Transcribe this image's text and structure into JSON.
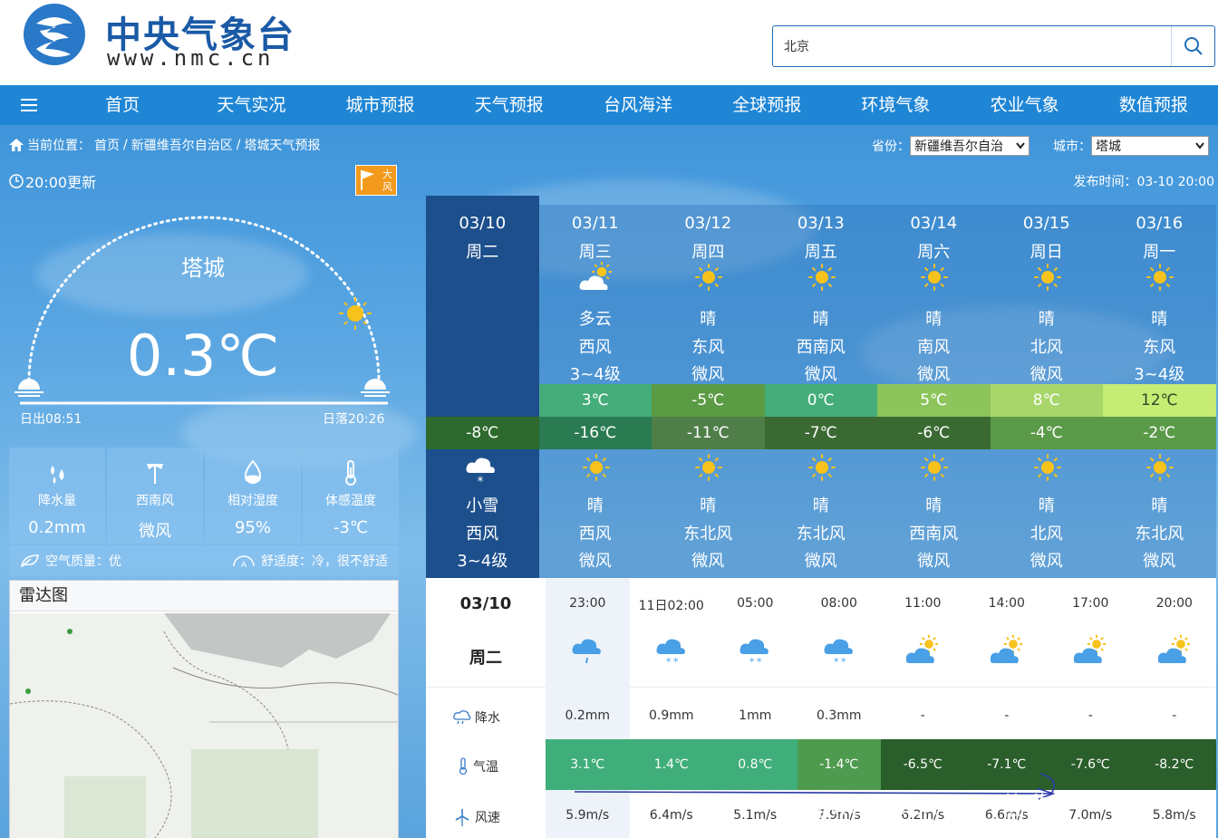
{
  "header": {
    "logo_cn": "中央气象台",
    "logo_en": "www.nmc.cn",
    "search_value": "北京"
  },
  "nav": {
    "items": [
      "首页",
      "天气实况",
      "城市预报",
      "天气预报",
      "台风海洋",
      "全球预报",
      "环境气象",
      "农业气象",
      "数值预报"
    ]
  },
  "breadcrumb": {
    "prefix": "当前位置：",
    "items": [
      "首页",
      "新疆维吾尔自治区",
      "塔城天气预报"
    ]
  },
  "selectors": {
    "province_label": "省份：",
    "province_value": "新疆维吾尔自治",
    "city_label": "城市：",
    "city_value": "塔城"
  },
  "update_time": "20:00更新",
  "warning_badge": {
    "line1": "大",
    "line2": "风",
    "color": "#f39a1c"
  },
  "publish_time": "发布时间：03-10 20:00",
  "current": {
    "city": "塔城",
    "temperature": "0.3℃",
    "sunrise": "日出08:51",
    "sunset": "日落20:26",
    "stats": [
      {
        "icon": "raindrops-icon",
        "label": "降水量",
        "value": "0.2mm"
      },
      {
        "icon": "wind-vane-icon",
        "label": "西南风",
        "value": "微风"
      },
      {
        "icon": "humidity-icon",
        "label": "相对湿度",
        "value": "95%"
      },
      {
        "icon": "thermometer-icon",
        "label": "体感温度",
        "value": "-3℃"
      }
    ],
    "air_quality": "空气质量：优",
    "comfort": "舒适度：冷，很不舒适"
  },
  "radar": {
    "title": "雷达图"
  },
  "forecast": [
    {
      "date": "03/10",
      "weekday": "周二",
      "day_weather": "",
      "day_wind_dir": "",
      "day_wind_level": "",
      "high": "",
      "low": "-8℃",
      "night_weather": "小雪",
      "night_wind_dir": "西风",
      "night_wind_level": "3~4级"
    },
    {
      "date": "03/11",
      "weekday": "周三",
      "day_weather": "多云",
      "day_wind_dir": "西风",
      "day_wind_level": "3~4级",
      "high": "3℃",
      "low": "-16℃",
      "night_weather": "晴",
      "night_wind_dir": "西风",
      "night_wind_level": "微风"
    },
    {
      "date": "03/12",
      "weekday": "周四",
      "day_weather": "晴",
      "day_wind_dir": "东风",
      "day_wind_level": "微风",
      "high": "-5℃",
      "low": "-11℃",
      "night_weather": "晴",
      "night_wind_dir": "东北风",
      "night_wind_level": "微风"
    },
    {
      "date": "03/13",
      "weekday": "周五",
      "day_weather": "晴",
      "day_wind_dir": "西南风",
      "day_wind_level": "微风",
      "high": "0℃",
      "low": "-7℃",
      "night_weather": "晴",
      "night_wind_dir": "东北风",
      "night_wind_level": "微风"
    },
    {
      "date": "03/14",
      "weekday": "周六",
      "day_weather": "晴",
      "day_wind_dir": "南风",
      "day_wind_level": "微风",
      "high": "5℃",
      "low": "-6℃",
      "night_weather": "晴",
      "night_wind_dir": "西南风",
      "night_wind_level": "微风"
    },
    {
      "date": "03/15",
      "weekday": "周日",
      "day_weather": "晴",
      "day_wind_dir": "北风",
      "day_wind_level": "微风",
      "high": "8℃",
      "low": "-4℃",
      "night_weather": "晴",
      "night_wind_dir": "北风",
      "night_wind_level": "微风"
    },
    {
      "date": "03/16",
      "weekday": "周一",
      "day_weather": "晴",
      "day_wind_dir": "东风",
      "day_wind_level": "3~4级",
      "high": "12℃",
      "low": "-2℃",
      "night_weather": "晴",
      "night_wind_dir": "东北风",
      "night_wind_level": "微风"
    }
  ],
  "high_colors": [
    "",
    "#44ad7a",
    "#5b9b44",
    "#44ad7a",
    "#8dc55c",
    "#a8d66b",
    "#c6ec74"
  ],
  "low_colors": [
    "#2e6a2e",
    "#2a7a52",
    "#4f7e48",
    "#3a6a32",
    "#3a6a32",
    "#5a9a48",
    "#5a9a48"
  ],
  "hourly": {
    "date": "03/10",
    "weekday": "周二",
    "row_labels": [
      "降水",
      "气温",
      "风速"
    ],
    "times": [
      "23:00",
      "11日02:00",
      "05:00",
      "08:00",
      "11:00",
      "14:00",
      "17:00",
      "20:00"
    ],
    "icons": [
      "rain-cloud-icon",
      "snow-cloud-icon",
      "snow-cloud-icon",
      "snow-cloud-icon",
      "partly-cloudy-icon",
      "partly-cloudy-icon",
      "partly-cloudy-icon",
      "partly-cloudy-icon"
    ],
    "precip": [
      "0.2mm",
      "0.9mm",
      "1mm",
      "0.3mm",
      "-",
      "-",
      "-",
      "-"
    ],
    "temps": [
      "3.1℃",
      "1.4℃",
      "0.8℃",
      "-1.4℃",
      "-6.5℃",
      "-7.1℃",
      "-7.6℃",
      "-8.2℃"
    ],
    "temp_colors": [
      "#3fae7a",
      "#3fae7a",
      "#3fae7a",
      "#4e9a4e",
      "#2a5e2a",
      "#2a5e2a",
      "#2a5e2a",
      "#2a5e2a"
    ],
    "wind": [
      "5.9m/s",
      "6.4m/s",
      "5.1m/s",
      "7.9m/s",
      "6.2m/s",
      "6.6m/s",
      "7.0m/s",
      "5.8m/s"
    ]
  },
  "watermark": "@weatherman_信欣"
}
